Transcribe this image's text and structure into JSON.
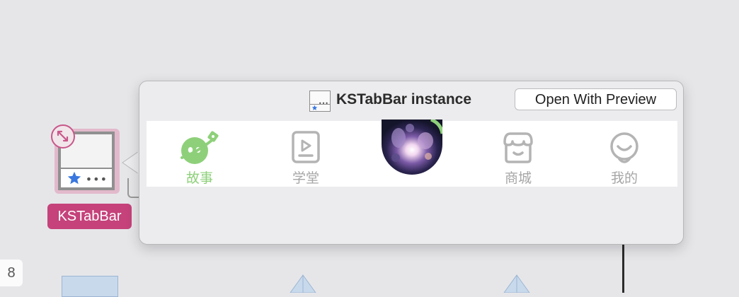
{
  "popover": {
    "title": "KSTabBar instance",
    "open_button": "Open With Preview"
  },
  "tabbar": {
    "active_color": "#8ed07a",
    "inactive_color": "#a6a6a6",
    "tabs": [
      {
        "label": "故事",
        "icon": "planet-icon",
        "active": true
      },
      {
        "label": "学堂",
        "icon": "play-document-icon",
        "active": false
      },
      {
        "label": "",
        "icon": "avatar-image",
        "active": false
      },
      {
        "label": "商城",
        "icon": "shop-icon",
        "active": false
      },
      {
        "label": "我的",
        "icon": "smiley-icon",
        "active": false
      }
    ]
  },
  "canvas": {
    "node_label": "KSTabBar",
    "side_badge": "8",
    "accent_color": "#c5427a"
  }
}
